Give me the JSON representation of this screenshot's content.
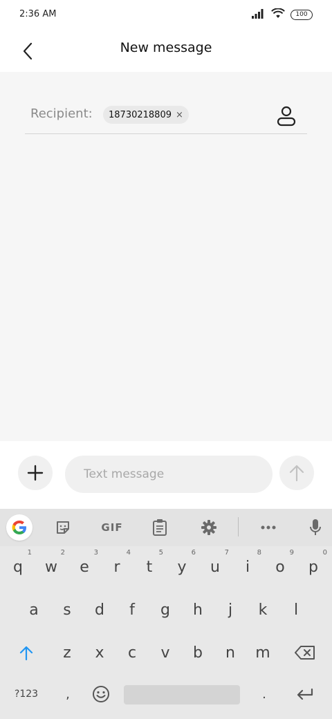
{
  "status_bar": {
    "time": "2:36 AM",
    "battery": "100",
    "icons": [
      "signal-icon",
      "wifi-icon",
      "battery-icon"
    ]
  },
  "header": {
    "title": "New message",
    "back_icon": "back-arrow-icon"
  },
  "recipient": {
    "label": "Recipient:",
    "chip_number": "18730218809",
    "chip_remove_glyph": "×",
    "contact_icon": "person-icon"
  },
  "compose": {
    "placeholder": "Text message",
    "attach_icon": "plus-icon",
    "send_icon": "arrow-up-icon"
  },
  "keyboard": {
    "toolbar": {
      "gif_label": "GIF",
      "items": [
        "google-icon",
        "sticker-icon",
        "gif",
        "clipboard-icon",
        "settings-icon",
        "more-icon",
        "mic-icon"
      ]
    },
    "row1": [
      {
        "key": "q",
        "hint": "1"
      },
      {
        "key": "w",
        "hint": "2"
      },
      {
        "key": "e",
        "hint": "3"
      },
      {
        "key": "r",
        "hint": "4"
      },
      {
        "key": "t",
        "hint": "5"
      },
      {
        "key": "y",
        "hint": "6"
      },
      {
        "key": "u",
        "hint": "7"
      },
      {
        "key": "i",
        "hint": "8"
      },
      {
        "key": "o",
        "hint": "9"
      },
      {
        "key": "p",
        "hint": "0"
      }
    ],
    "row2": [
      "a",
      "s",
      "d",
      "f",
      "g",
      "h",
      "j",
      "k",
      "l"
    ],
    "row3": [
      "z",
      "x",
      "c",
      "v",
      "b",
      "n",
      "m"
    ],
    "symbols_label": "?123",
    "comma": ",",
    "period": ".",
    "shift_icon": "shift-arrow-icon",
    "backspace_icon": "backspace-icon",
    "emoji_icon": "emoji-icon",
    "enter_icon": "enter-icon"
  },
  "colors": {
    "accent_shift": "#2196f3",
    "content_bg": "#f6f6f6",
    "keyboard_bg": "#e8e8e8"
  }
}
